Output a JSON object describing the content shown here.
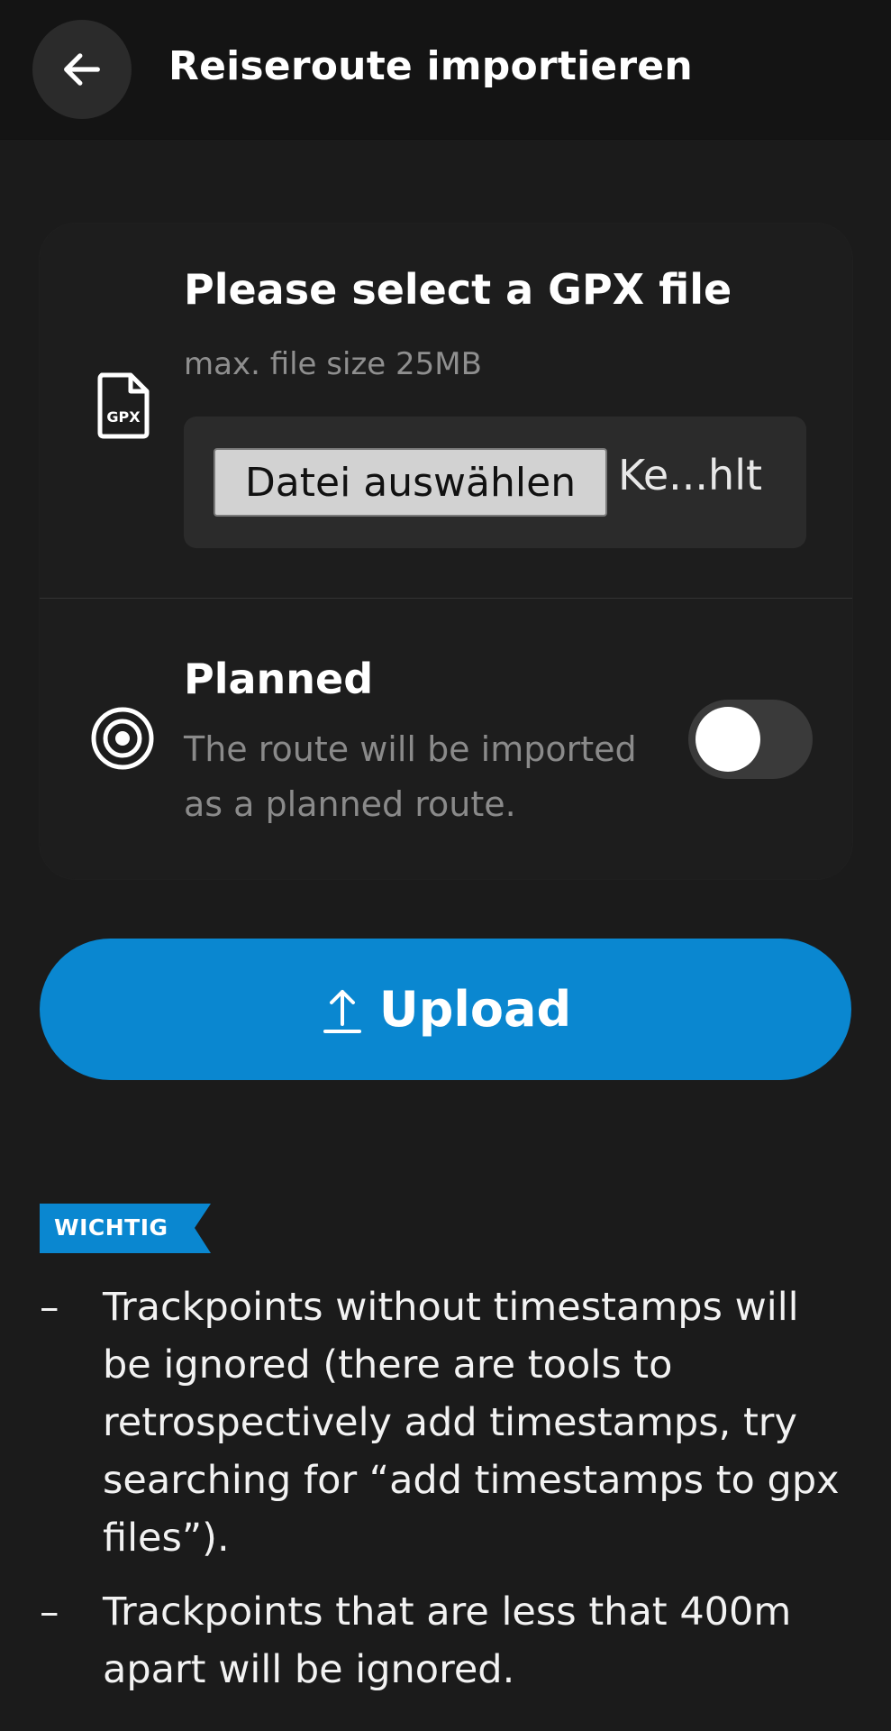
{
  "header": {
    "title": "Reiseroute importieren",
    "back_icon": "arrow-left-icon"
  },
  "gpx_section": {
    "icon": "gpx-file-icon",
    "icon_text": "GPX",
    "title": "Please select a GPX file",
    "subtitle": "max. file size 25MB",
    "file_button_label": "Datei auswählen",
    "file_status": "Ke...hlt"
  },
  "planned_section": {
    "icon": "target-icon",
    "title": "Planned",
    "description_line1": "The route will be imported",
    "description_line2": "as a planned route.",
    "toggle_on": false
  },
  "upload": {
    "icon": "upload-icon",
    "label": "Upload",
    "color": "#0a87d0"
  },
  "important": {
    "badge": "WICHTIG",
    "badge_color": "#0a87d0",
    "items": [
      "Trackpoints without timestamps will be ignored (there are tools to retrospectively add timestamps, try searching for “add timestamps to gpx files”).",
      "Trackpoints that are less that 400m apart will be ignored."
    ]
  }
}
